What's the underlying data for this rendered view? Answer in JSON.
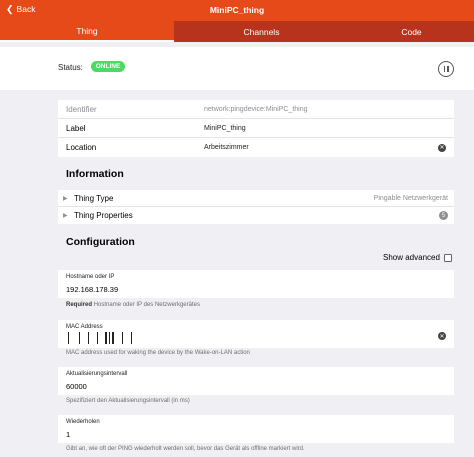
{
  "header": {
    "back_label": "Back",
    "title": "MiniPC_thing"
  },
  "tabs": [
    {
      "label": "Thing",
      "active": true
    },
    {
      "label": "Channels",
      "active": false
    },
    {
      "label": "Code",
      "active": false
    }
  ],
  "status": {
    "label": "Status:",
    "badge": "ONLINE",
    "badge_color": "#4cd964"
  },
  "props": {
    "identifier_label": "Identifier",
    "identifier_value": "network:pingdevice:MiniPC_thing",
    "label_label": "Label",
    "label_value": "MiniPC_thing",
    "location_label": "Location",
    "location_value": "Arbeitszimmer"
  },
  "information": {
    "title": "Information",
    "thing_type_label": "Thing Type",
    "thing_type_value": "Pingable Netzwerkgerät",
    "thing_props_label": "Thing Properties",
    "thing_props_count": "5"
  },
  "configuration": {
    "title": "Configuration",
    "show_advanced": "Show advanced",
    "hostname_label": "Hostname oder IP",
    "hostname_value": "192.168.178.39",
    "hostname_required": "Required",
    "hostname_hint": "Hostname oder IP des Netzwerkgerätes",
    "mac_label": "MAC Address",
    "mac_hint": "MAC address used for waking the device by the Wake-on-LAN action",
    "interval_label": "Aktualisierungsintervall",
    "interval_value": "60000",
    "interval_hint": "Spezifiziert den Aktualisierungsintervall (in ms)",
    "retry_label": "Wiederholen",
    "retry_value": "1",
    "retry_hint": "Gibt an, wie oft der PING wiederholt werden soll, bevor das Gerät als offline markiert wird."
  },
  "colors": {
    "accent": "#e64a19",
    "tab_inactive": "#b7331b"
  },
  "icons": {
    "back": "chevron-left-icon",
    "pause": "pause-icon",
    "clear": "clear-icon",
    "expand": "triangle-right-icon"
  }
}
